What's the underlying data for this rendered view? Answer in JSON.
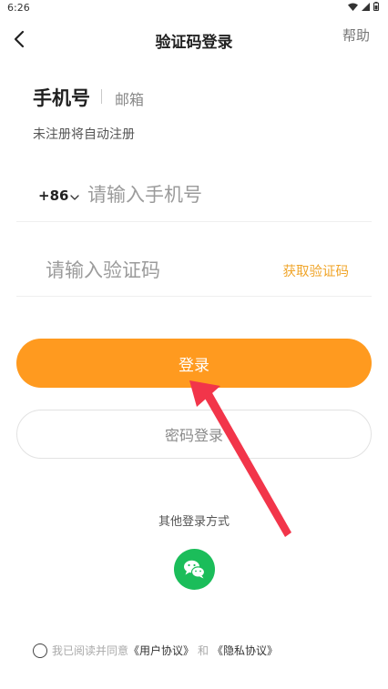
{
  "status_bar": {
    "time": "6:26"
  },
  "header": {
    "title": "验证码登录",
    "help_label": "帮助"
  },
  "tabs": {
    "phone_label": "手机号",
    "email_label": "邮箱"
  },
  "hint": "未注册将自动注册",
  "phone_field": {
    "country_code": "+86",
    "value": "",
    "placeholder": "请输入手机号"
  },
  "code_field": {
    "value": "",
    "placeholder": "请输入验证码",
    "get_code_label": "获取验证码"
  },
  "buttons": {
    "login_label": "登录",
    "password_login_label": "密码登录"
  },
  "other_methods_label": "其他登录方式",
  "agreement": {
    "prefix": "我已阅读并同意",
    "user_agreement": "《用户协议》",
    "and_text": "和",
    "privacy_policy": "《隐私协议》"
  },
  "colors": {
    "accent": "#ff9a1f",
    "link_orange": "#f0a52a",
    "wechat_green": "#1bbd5a",
    "annotation_red": "#f2354a"
  },
  "icons": {
    "back": "back-arrow-icon",
    "chevron": "chevron-down-icon",
    "wechat": "wechat-icon",
    "wifi": "wifi-icon",
    "signal": "signal-icon",
    "battery": "battery-icon"
  }
}
